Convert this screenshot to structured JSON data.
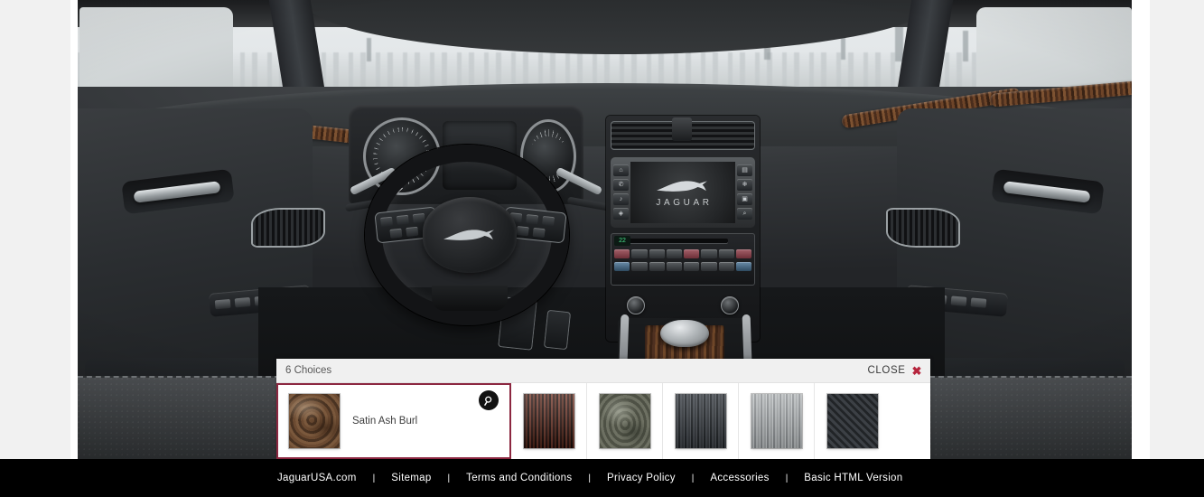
{
  "choice_panel": {
    "count_label": "6 Choices",
    "close_label": "CLOSE",
    "close_icon": "close-x-icon",
    "magnifier_icon": "magnifier-icon",
    "selected_index": 0,
    "swatches": [
      {
        "name": "Satin Ash Burl",
        "key": "satin-ash-burl",
        "selected": true
      },
      {
        "name": "",
        "key": "gloss-figured-ebony",
        "selected": false
      },
      {
        "name": "",
        "key": "grey-figured-ash",
        "selected": false
      },
      {
        "name": "",
        "key": "dark-grey-oak",
        "selected": false
      },
      {
        "name": "",
        "key": "light-grey-ash",
        "selected": false
      },
      {
        "name": "",
        "key": "carbon-fibre",
        "selected": false
      }
    ],
    "accent_color": "#8c2740",
    "close_color": "#b6253d"
  },
  "hero": {
    "alt": "Jaguar vehicle interior with dashboard, steering wheel and wood veneer trim",
    "infotainment_wordmark": "JAGUAR",
    "brand_emblem": "jaguar-leaper-icon"
  },
  "footer": {
    "links": [
      "JaguarUSA.com",
      "Sitemap",
      "Terms and Conditions",
      "Privacy Policy",
      "Accessories",
      "Basic HTML Version"
    ],
    "separator": "|",
    "background_color": "#000000"
  },
  "page": {
    "background_color": "#f1f1f1"
  }
}
